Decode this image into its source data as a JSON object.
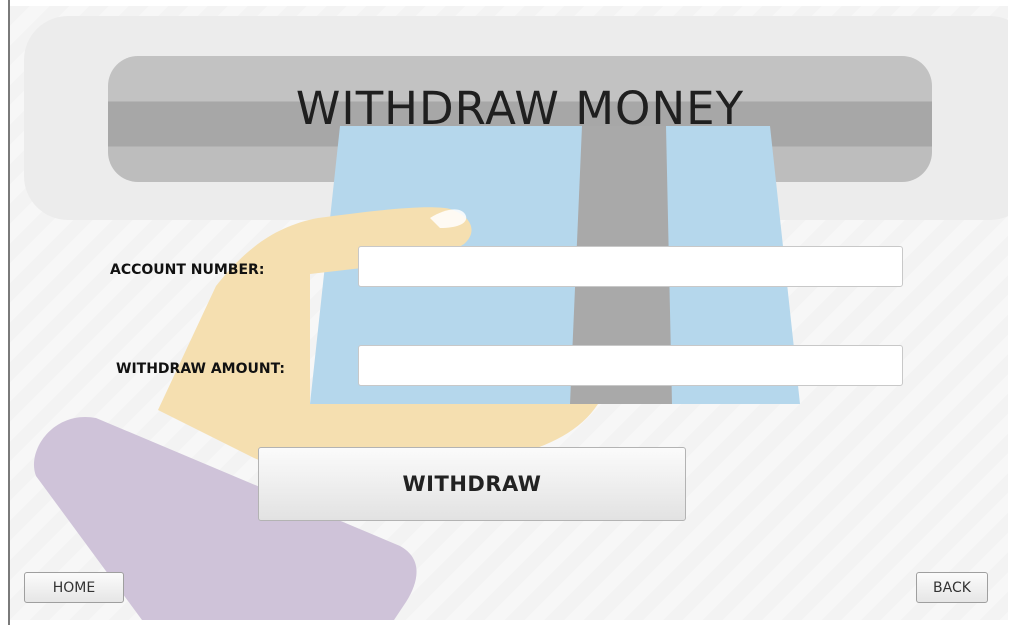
{
  "screen": {
    "title": "WITHDRAW MONEY"
  },
  "form": {
    "account_number": {
      "label": "ACCOUNT NUMBER:",
      "value": ""
    },
    "withdraw_amount": {
      "label": "WITHDRAW AMOUNT:",
      "value": ""
    },
    "submit_label": "WITHDRAW"
  },
  "navigation": {
    "home_label": "HOME",
    "back_label": "BACK"
  },
  "colors": {
    "card": "#b5d7ec",
    "hand": "#f5dfb0",
    "sleeve": "#cfc3d9",
    "slot": "#a7a7a7",
    "housing": "#ececec"
  }
}
